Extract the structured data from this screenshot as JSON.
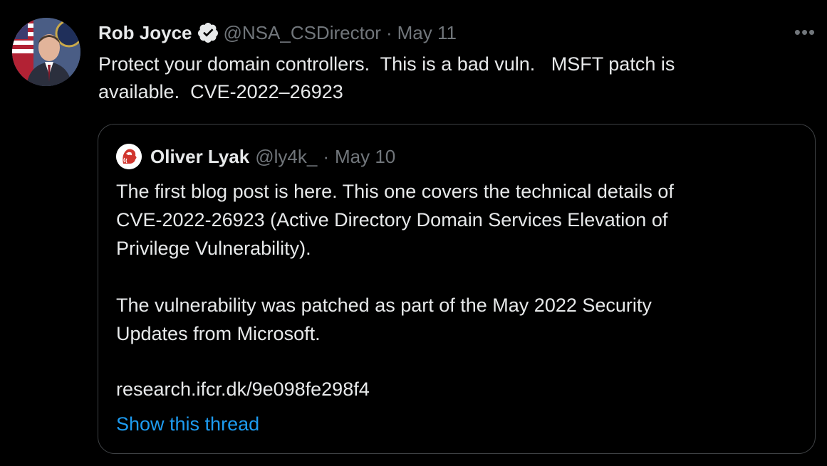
{
  "tweet": {
    "author": {
      "display_name": "Rob Joyce",
      "handle": "@NSA_CSDirector",
      "avatar_icon": "profile-photo-avatar",
      "verified_icon": "verified-badge-icon"
    },
    "separator": "·",
    "date": "May 11",
    "more_icon": "more-options-icon",
    "more_label": "•••",
    "text": "Protect your domain controllers.  This is a bad vuln.   MSFT patch is\navailable.  CVE-2022–26923"
  },
  "quoted_tweet": {
    "author": {
      "display_name": "Oliver Lyak",
      "handle": "@ly4k_",
      "avatar_icon": "lion-logo-avatar"
    },
    "separator": "·",
    "date": "May 10",
    "text": "The first blog post is here. This one covers the technical details of\nCVE-2022-26923 (Active Directory Domain Services Elevation of\nPrivilege Vulnerability).\n\nThe vulnerability was patched as part of the May 2022 Security\nUpdates from Microsoft.",
    "link": "research.ifcr.dk/9e098fe298f4",
    "show_thread_label": "Show this thread"
  },
  "colors": {
    "background": "#000000",
    "text_primary": "#e7e9ea",
    "text_secondary": "#71767b",
    "link_blue": "#1d9bf0",
    "border": "#3e4144"
  }
}
